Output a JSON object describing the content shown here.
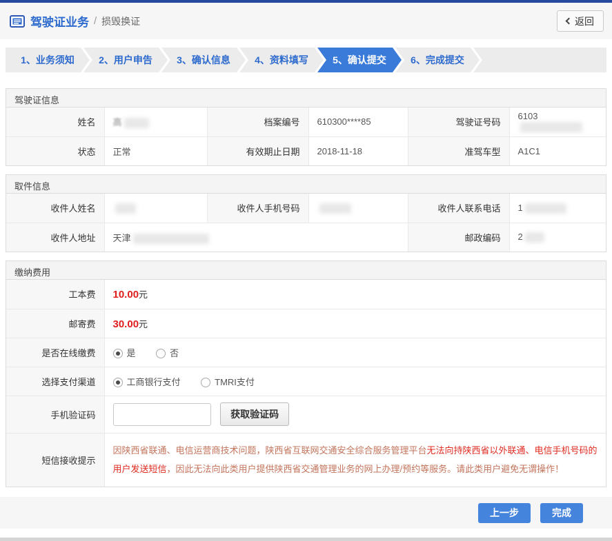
{
  "header": {
    "title": "驾驶证业务",
    "separator": "/",
    "subtitle": "损毁换证",
    "back_label": "返回"
  },
  "steps": [
    {
      "label": "1、业务须知",
      "active": false
    },
    {
      "label": "2、用户申告",
      "active": false
    },
    {
      "label": "3、确认信息",
      "active": false
    },
    {
      "label": "4、资料填写",
      "active": false
    },
    {
      "label": "5、确认提交",
      "active": true
    },
    {
      "label": "6、完成提交",
      "active": false
    }
  ],
  "license": {
    "title": "驾驶证信息",
    "rows": [
      [
        {
          "label": "姓名",
          "value": "高",
          "masked": true
        },
        {
          "label": "档案编号",
          "value": "610300****85",
          "masked": false
        },
        {
          "label": "驾驶证号码",
          "value": "6103",
          "masked": true
        }
      ],
      [
        {
          "label": "状态",
          "value": "正常",
          "masked": false
        },
        {
          "label": "有效期止日期",
          "value": "2018-11-18",
          "masked": false
        },
        {
          "label": "准驾车型",
          "value": "A1C1",
          "masked": false
        }
      ]
    ]
  },
  "pickup": {
    "title": "取件信息",
    "row0": [
      {
        "label": "收件人姓名",
        "value": "",
        "masked": true
      },
      {
        "label": "收件人手机号码",
        "value": "",
        "masked": true
      },
      {
        "label": "收件人联系电话",
        "value": "1",
        "masked": true
      }
    ],
    "row1": [
      {
        "label": "收件人地址",
        "value": "天津",
        "masked": true
      },
      {
        "label": "邮政编码",
        "value": "2",
        "masked": true
      }
    ]
  },
  "payment": {
    "title": "缴纳费用",
    "fee1": {
      "label": "工本费",
      "amount": "10.00",
      "unit": "元"
    },
    "fee2": {
      "label": "邮寄费",
      "amount": "30.00",
      "unit": "元"
    },
    "online": {
      "label": "是否在线缴费",
      "yes": "是",
      "no": "否",
      "selected": "是"
    },
    "channel": {
      "label": "选择支付渠道",
      "opt1": "工商银行支付",
      "opt2": "TMRI支付",
      "selected": "工商银行支付"
    },
    "code": {
      "label": "手机验证码",
      "value": "",
      "button": "获取验证码"
    },
    "notice": {
      "label": "短信接收提示",
      "part1": "因陕西省联通、电信运营商技术问题，陕西省互联网交通安全综合服务管理平台",
      "part2": "无法向持陕西省以外联通、电信手机号码的用户发送短信",
      "part3": "，因此无法向此类用户提供陕西省交通管理业务的网上办理/预约等服务。请此类用户避免无谓操作！"
    }
  },
  "footer": {
    "prev_label": "上一步",
    "finish_label": "完成"
  },
  "colors": {
    "topbar_blue": "#274a9f",
    "brand_blue": "#2d6ace",
    "active_step_blue": "#3a7ad9",
    "button_blue": "#4484dd",
    "fee_red": "#e01d1d",
    "notice_strong_red": "#e02b20",
    "notice_light_red": "#c3745c"
  }
}
